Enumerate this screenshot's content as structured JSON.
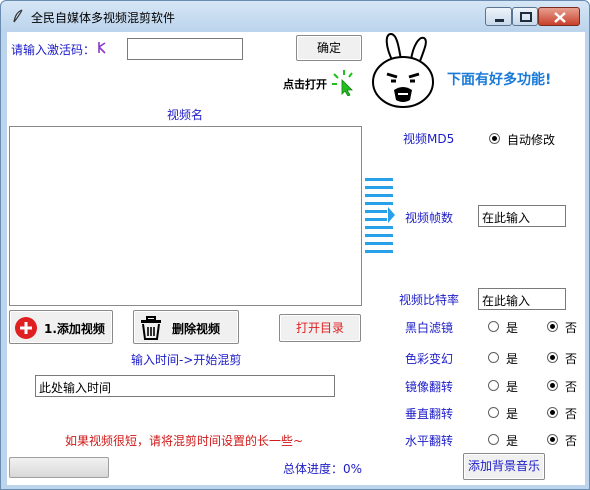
{
  "window": {
    "title": "全民自媒体多视频混剪软件"
  },
  "activation": {
    "label": "请输入激活码：",
    "input_value": "",
    "confirm_label": "确定",
    "click_open_label": "点击打开",
    "promo_text": "下面有好多功能!"
  },
  "video_list": {
    "header": "视频名",
    "items": []
  },
  "buttons": {
    "add_video": "1.添加视频",
    "delete_video": "删除视频",
    "open_dir": "打开目录",
    "add_music": "添加背景音乐"
  },
  "mix": {
    "time_label": "输入时间->开始混剪",
    "time_value": "此处输入时间",
    "hint": "如果视频很短，请将混剪时间设置的长一些~",
    "progress_label": "总体进度：0%",
    "progress": 0
  },
  "settings": {
    "md5_label": "视频MD5",
    "md5_option": "自动修改",
    "fps_label": "视频帧数",
    "fps_value": "在此输入",
    "bitrate_label": "视频比特率",
    "bitrate_value": "在此输入",
    "yes": "是",
    "no": "否",
    "filters": [
      {
        "label": "黑白滤镜",
        "selected": "no"
      },
      {
        "label": "色彩变幻",
        "selected": "no"
      },
      {
        "label": "镜像翻转",
        "selected": "no"
      },
      {
        "label": "垂直翻转",
        "selected": "no"
      },
      {
        "label": "水平翻转",
        "selected": "no"
      }
    ]
  },
  "colors": {
    "label_blue": "#1c1cc8",
    "hint_red": "#d01818",
    "open_dir_red": "#e02020",
    "promo_blue": "#1a7ad8",
    "arrow_blue": "#2aa0e8",
    "sparkle_green": "#20c020",
    "add_icon_red": "#e02020"
  }
}
